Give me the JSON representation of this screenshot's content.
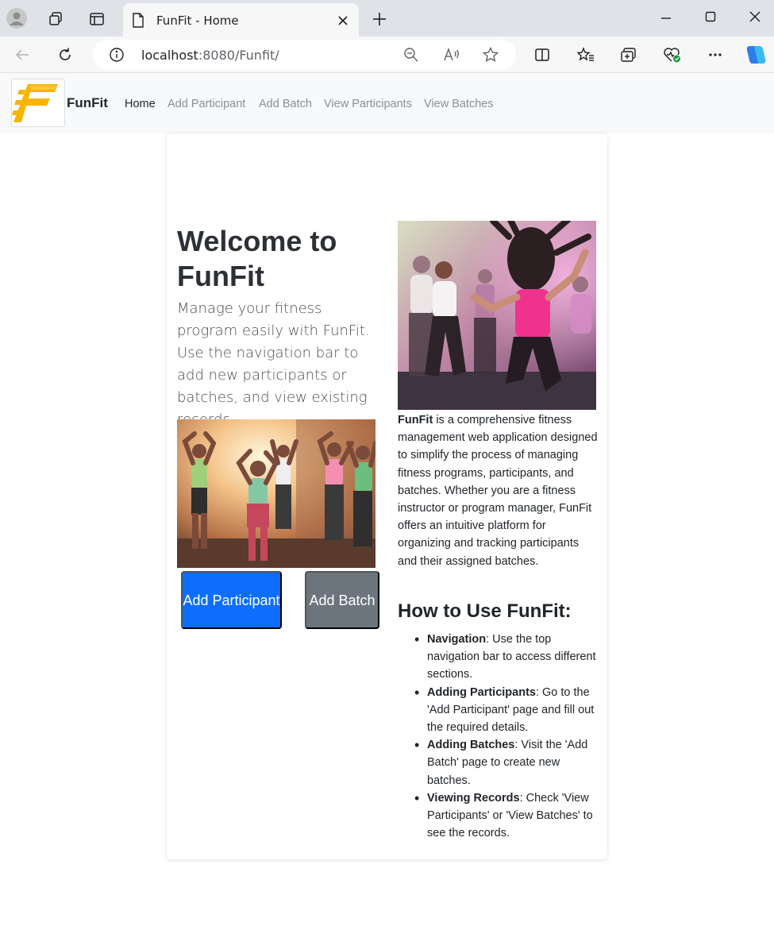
{
  "browser": {
    "tab_title": "FunFit - Home",
    "url_host": "localhost",
    "url_rest": ":8080/Funfit/"
  },
  "navbar": {
    "brand": "FunFit",
    "links": [
      {
        "label": "Home",
        "active": true
      },
      {
        "label": "Add Participant",
        "active": false
      },
      {
        "label": "Add Batch",
        "active": false
      },
      {
        "label": "View Participants",
        "active": false
      },
      {
        "label": "View Batches",
        "active": false
      }
    ]
  },
  "hero": {
    "title": "Welcome to FunFit",
    "lead": "Manage your fitness program easily with FunFit. Use the navigation bar to add new participants or batches, and view existing records."
  },
  "buttons": {
    "add_participant": "Add Participant",
    "add_batch": "Add Batch"
  },
  "about": {
    "brand": "FunFit",
    "text": " is a comprehensive fitness management web application designed to simplify the process of managing fitness programs, participants, and batches. Whether you are a fitness instructor or program manager, FunFit offers an intuitive platform for organizing and tracking participants and their assigned batches."
  },
  "howto": {
    "title": "How to Use FunFit:",
    "items": [
      {
        "term": "Navigation",
        "text": ": Use the top navigation bar to access different sections."
      },
      {
        "term": "Adding Participants",
        "text": ": Go to the 'Add Participant' page and fill out the required details."
      },
      {
        "term": "Adding Batches",
        "text": ": Visit the 'Add Batch' page to create new batches."
      },
      {
        "term": "Viewing Records",
        "text": ": Check 'View Participants' or 'View Batches' to see the records."
      }
    ]
  },
  "colors": {
    "primary": "#0d6efd",
    "secondary": "#6c757d",
    "logo_yellow": "#f7b500"
  }
}
